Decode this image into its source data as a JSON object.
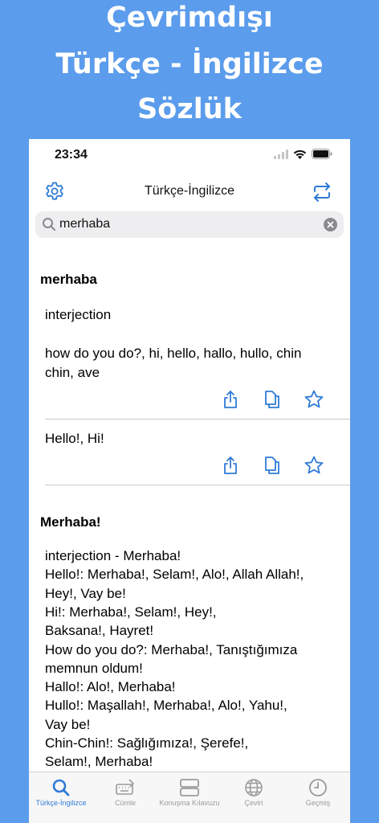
{
  "promo": {
    "line1": "Çevrimdışı",
    "line2": "Türkçe - İngilizce",
    "line3": "Sözlük"
  },
  "status": {
    "time": "23:34"
  },
  "nav": {
    "title": "Türkçe-İngilizce"
  },
  "search": {
    "value": "merhaba",
    "placeholder": ""
  },
  "entries": [
    {
      "headword": "merhaba",
      "senses": [
        {
          "pos": "interjection",
          "text": "how do you do?, hi, hello, hallo, hullo, chin chin, ave"
        },
        {
          "text": "Hello!, Hi!"
        }
      ]
    },
    {
      "headword": "Merhaba!",
      "lines": [
        "interjection - Merhaba!",
        "Hello!: Merhaba!, Selam!, Alo!, Allah Allah!,",
        "Hey!, Vay be!",
        "Hi!: Merhaba!, Selam!, Hey!,",
        "Baksana!, Hayret!",
        "How do you do?: Merhaba!, Tanıştığımıza",
        "memnun oldum!",
        "Hallo!: Alo!, Merhaba!",
        "Hullo!: Maşallah!, Merhaba!, Alo!, Yahu!,",
        "Vay be!",
        "Chin-Chin!: Sağlığımıza!, Şerefe!,",
        "Selam!, Merhaba!"
      ]
    }
  ],
  "tabs": [
    {
      "label": "Türkçe-İngilizce",
      "icon": "search-icon",
      "active": true
    },
    {
      "label": "Cümle",
      "icon": "keyboard-pencil-icon",
      "active": false
    },
    {
      "label": "Konuşma Kılavuzu",
      "icon": "stacked-rectangles-icon",
      "active": false
    },
    {
      "label": "Çeviri",
      "icon": "globe-icon",
      "active": false
    },
    {
      "label": "Geçmiş",
      "icon": "clock-icon",
      "active": false
    }
  ],
  "colors": {
    "accent": "#2f7bd6",
    "background": "#5b9cec",
    "inactive": "#9a9a9a"
  }
}
